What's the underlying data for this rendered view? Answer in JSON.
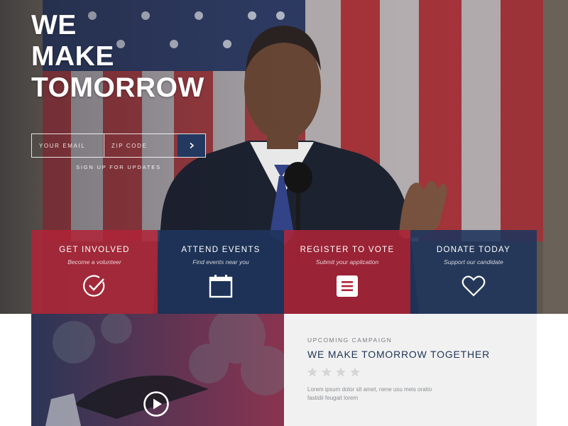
{
  "hero": {
    "headline_lines": [
      "WE",
      "MAKE",
      "TOMORROW"
    ],
    "signup": {
      "email_placeholder": "YOUR EMAIL",
      "zip_placeholder": "ZIP CODE",
      "submit_icon": "chevron-right-icon",
      "note": "SIGN UP FOR UPDATES"
    }
  },
  "cards": [
    {
      "title": "GET INVOLVED",
      "subtitle": "Become a volunteer",
      "icon": "check-circle-icon",
      "color": "#b02438"
    },
    {
      "title": "ATTEND EVENTS",
      "subtitle": "Find events near you",
      "icon": "calendar-icon",
      "color": "#1e345c"
    },
    {
      "title": "REGISTER TO VOTE",
      "subtitle": "Submit your application",
      "icon": "document-icon",
      "color": "#b02438"
    },
    {
      "title": "DONATE TODAY",
      "subtitle": "Support our candidate",
      "icon": "heart-icon",
      "color": "#1e345c"
    }
  ],
  "campaign": {
    "kicker": "UPCOMING CAMPAIGN",
    "title": "WE MAKE TOMORROW TOGETHER",
    "rating": 0,
    "rating_max": 4,
    "body": "Lorem ipsum dolor sit amet, nene usu meis oratio fastidii feugait lorem"
  },
  "video": {
    "play_icon": "play-circle-icon"
  },
  "colors": {
    "accent_red": "#b02438",
    "accent_blue": "#1e345c",
    "title_blue": "#1f3556",
    "panel_gray": "#f1f1f1"
  }
}
